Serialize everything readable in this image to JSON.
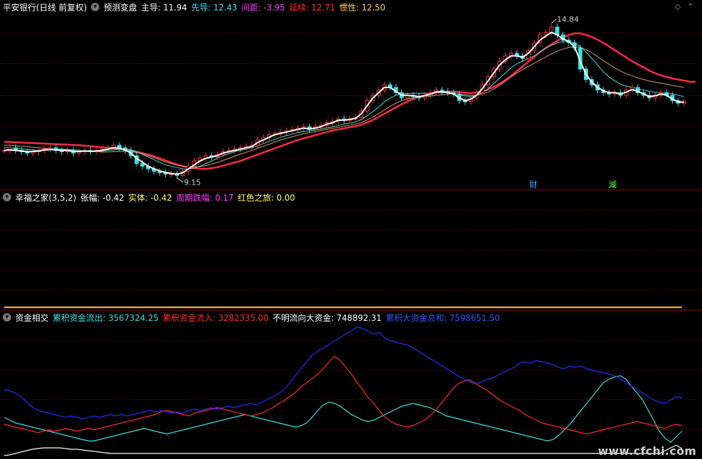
{
  "price_panel": {
    "title": "平安银行(日线 前复权)",
    "indicator_name": "预测变盘",
    "items": [
      {
        "label": "主导:",
        "value": "11.94",
        "color": "#ffffff"
      },
      {
        "label": "先导:",
        "value": "12.43",
        "color": "#40e0ff"
      },
      {
        "label": "间距:",
        "value": "-3.95",
        "color": "#ff40ff"
      },
      {
        "label": "延续:",
        "value": "12.71",
        "color": "#ff3030"
      },
      {
        "label": "惯性:",
        "value": "12.50",
        "color": "#ffcc66"
      }
    ],
    "high_label": "14.84",
    "low_label": "9.15",
    "marker_cai": "财",
    "marker_jian": "減",
    "candles": [
      10.1,
      10.2,
      10.1,
      10.05,
      10.0,
      10.05,
      10.1,
      10.15,
      10.2,
      10.1,
      10.05,
      10.1,
      10.0,
      10.05,
      10.1,
      10.05,
      10.1,
      10.15,
      10.2,
      10.3,
      10.2,
      10.1,
      9.9,
      9.6,
      9.5,
      9.4,
      9.3,
      9.25,
      9.2,
      9.2,
      9.15,
      9.3,
      9.5,
      9.7,
      9.8,
      9.9,
      9.85,
      9.95,
      10.05,
      10.1,
      10.15,
      10.2,
      10.25,
      10.3,
      10.5,
      10.6,
      10.7,
      10.75,
      10.8,
      10.85,
      10.9,
      10.95,
      11.0,
      10.9,
      11.0,
      11.05,
      11.15,
      11.2,
      11.3,
      11.25,
      11.3,
      11.35,
      11.6,
      12.0,
      12.2,
      12.4,
      12.6,
      12.5,
      12.3,
      12.1,
      12.2,
      12.15,
      12.1,
      12.2,
      12.3,
      12.4,
      12.35,
      12.3,
      12.25,
      12.0,
      11.95,
      12.1,
      12.3,
      12.6,
      12.9,
      13.2,
      13.5,
      13.7,
      13.8,
      13.7,
      13.6,
      13.9,
      14.2,
      14.5,
      14.6,
      14.8,
      14.5,
      14.3,
      14.2,
      14.0,
      13.2,
      12.8,
      12.6,
      12.4,
      12.3,
      12.25,
      12.3,
      12.2,
      12.4,
      12.5,
      12.3,
      12.2,
      12.1,
      12.2,
      12.3,
      12.2,
      12.0,
      11.9,
      11.94
    ],
    "ma_white": [
      10.1,
      10.12,
      10.1,
      10.08,
      10.05,
      10.06,
      10.08,
      10.12,
      10.14,
      10.12,
      10.1,
      10.1,
      10.06,
      10.06,
      10.08,
      10.06,
      10.08,
      10.1,
      10.15,
      10.2,
      10.18,
      10.12,
      10.0,
      9.8,
      9.65,
      9.5,
      9.4,
      9.32,
      9.26,
      9.22,
      9.2,
      9.25,
      9.4,
      9.55,
      9.7,
      9.8,
      9.85,
      9.9,
      10.0,
      10.05,
      10.1,
      10.15,
      10.2,
      10.25,
      10.4,
      10.5,
      10.6,
      10.7,
      10.75,
      10.8,
      10.85,
      10.9,
      10.95,
      10.92,
      10.95,
      11.0,
      11.1,
      11.15,
      11.25,
      11.25,
      11.28,
      11.32,
      11.5,
      11.8,
      12.1,
      12.3,
      12.5,
      12.5,
      12.35,
      12.2,
      12.2,
      12.18,
      12.15,
      12.18,
      12.25,
      12.33,
      12.33,
      12.3,
      12.25,
      12.1,
      12.0,
      12.05,
      12.2,
      12.45,
      12.75,
      13.05,
      13.35,
      13.55,
      13.7,
      13.7,
      13.65,
      13.8,
      14.05,
      14.3,
      14.45,
      14.6,
      14.5,
      14.35,
      14.25,
      14.05,
      13.5,
      13.0,
      12.7,
      12.5,
      12.38,
      12.3,
      12.3,
      12.25,
      12.32,
      12.42,
      12.35,
      12.25,
      12.15,
      12.18,
      12.25,
      12.2,
      12.05,
      11.95,
      11.94
    ],
    "ma_cyan": [
      10.2,
      10.2,
      10.18,
      10.16,
      10.14,
      10.12,
      10.1,
      10.1,
      10.12,
      10.14,
      10.15,
      10.14,
      10.12,
      10.1,
      10.08,
      10.06,
      10.06,
      10.08,
      10.1,
      10.12,
      10.14,
      10.15,
      10.12,
      10.05,
      9.95,
      9.85,
      9.75,
      9.65,
      9.55,
      9.5,
      9.45,
      9.4,
      9.38,
      9.42,
      9.5,
      9.6,
      9.7,
      9.8,
      9.9,
      9.98,
      10.05,
      10.1,
      10.15,
      10.2,
      10.28,
      10.36,
      10.45,
      10.52,
      10.6,
      10.66,
      10.72,
      10.78,
      10.82,
      10.85,
      10.88,
      10.92,
      10.96,
      11.0,
      11.05,
      11.1,
      11.14,
      11.18,
      11.28,
      11.42,
      11.58,
      11.75,
      11.95,
      12.1,
      12.2,
      12.25,
      12.27,
      12.28,
      12.28,
      12.28,
      12.28,
      12.3,
      12.3,
      12.3,
      12.28,
      12.22,
      12.18,
      12.15,
      12.2,
      12.3,
      12.45,
      12.65,
      12.85,
      13.05,
      13.25,
      13.4,
      13.5,
      13.6,
      13.7,
      13.85,
      14.0,
      14.1,
      14.2,
      14.25,
      14.25,
      14.2,
      14.05,
      13.85,
      13.6,
      13.35,
      13.1,
      12.9,
      12.75,
      12.62,
      12.55,
      12.5,
      12.45,
      12.4,
      12.35,
      12.32,
      12.3,
      12.28,
      12.25,
      12.2,
      12.15
    ],
    "ma_yellow": [
      10.3,
      10.3,
      10.28,
      10.26,
      10.24,
      10.22,
      10.2,
      10.18,
      10.16,
      10.15,
      10.14,
      10.13,
      10.12,
      10.1,
      10.08,
      10.06,
      10.05,
      10.04,
      10.04,
      10.05,
      10.06,
      10.07,
      10.06,
      10.02,
      9.97,
      9.9,
      9.82,
      9.74,
      9.66,
      9.6,
      9.54,
      9.5,
      9.47,
      9.46,
      9.48,
      9.52,
      9.58,
      9.64,
      9.72,
      9.8,
      9.88,
      9.96,
      10.03,
      10.1,
      10.18,
      10.26,
      10.34,
      10.42,
      10.5,
      10.56,
      10.62,
      10.68,
      10.74,
      10.78,
      10.82,
      10.86,
      10.9,
      10.94,
      10.98,
      11.02,
      11.06,
      11.1,
      11.16,
      11.26,
      11.38,
      11.5,
      11.64,
      11.78,
      11.9,
      12.0,
      12.06,
      12.1,
      12.13,
      12.15,
      12.17,
      12.2,
      12.22,
      12.24,
      12.25,
      12.24,
      12.22,
      12.2,
      12.2,
      12.24,
      12.32,
      12.44,
      12.58,
      12.74,
      12.9,
      13.05,
      13.18,
      13.3,
      13.42,
      13.54,
      13.66,
      13.78,
      13.88,
      13.96,
      14.02,
      14.05,
      14.02,
      13.94,
      13.82,
      13.68,
      13.52,
      13.38,
      13.24,
      13.12,
      13.02,
      12.94,
      12.86,
      12.8,
      12.74,
      12.7,
      12.66,
      12.62,
      12.58,
      12.54,
      12.5
    ],
    "ma_red": [
      10.42,
      10.42,
      10.41,
      10.4,
      10.39,
      10.38,
      10.37,
      10.36,
      10.35,
      10.34,
      10.33,
      10.32,
      10.31,
      10.3,
      10.28,
      10.26,
      10.24,
      10.22,
      10.2,
      10.18,
      10.16,
      10.14,
      10.1,
      10.05,
      10.0,
      9.94,
      9.88,
      9.8,
      9.72,
      9.64,
      9.56,
      9.5,
      9.45,
      9.42,
      9.4,
      9.4,
      9.42,
      9.46,
      9.52,
      9.58,
      9.64,
      9.7,
      9.78,
      9.86,
      9.94,
      10.02,
      10.1,
      10.18,
      10.26,
      10.34,
      10.42,
      10.5,
      10.56,
      10.62,
      10.68,
      10.74,
      10.8,
      10.86,
      10.9,
      10.94,
      10.98,
      11.02,
      11.08,
      11.16,
      11.26,
      11.38,
      11.5,
      11.62,
      11.74,
      11.86,
      11.96,
      12.06,
      12.14,
      12.2,
      12.26,
      12.3,
      12.33,
      12.34,
      12.34,
      12.32,
      12.3,
      12.28,
      12.3,
      12.34,
      12.42,
      12.52,
      12.64,
      12.78,
      12.94,
      13.12,
      13.3,
      13.48,
      13.66,
      13.84,
      14.0,
      14.14,
      14.28,
      14.4,
      14.5,
      14.56,
      14.56,
      14.5,
      14.42,
      14.32,
      14.2,
      14.06,
      13.92,
      13.78,
      13.64,
      13.5,
      13.38,
      13.26,
      13.14,
      13.04,
      12.96,
      12.9,
      12.84,
      12.8,
      12.76,
      12.72,
      12.71
    ]
  },
  "xingfu_panel": {
    "name": "幸福之家(3,5,2)",
    "items": [
      {
        "label": "张幅:",
        "value": "-0.42",
        "color": "#ffffff"
      },
      {
        "label": "实体:",
        "value": "-0.42",
        "color": "#ffff66"
      },
      {
        "label": "周期跌幅:",
        "value": "0.17",
        "color": "#ff40ff"
      },
      {
        "label": "红色之旅:",
        "value": "0.00",
        "color": "#ffff66"
      }
    ]
  },
  "fund_panel": {
    "name": "资金相交",
    "items": [
      {
        "label": "累积资金流出:",
        "value": "3567324.25",
        "color": "#40e0e0"
      },
      {
        "label": "累积资金流入:",
        "value": "3282335.00",
        "color": "#ff3030"
      },
      {
        "label": "不明流向大资金:",
        "value": "748892.31",
        "color": "#ffffff"
      },
      {
        "label": "累积大资金总和:",
        "value": "7598651.50",
        "color": "#3355ff"
      }
    ],
    "blue": [
      560,
      562,
      565,
      570,
      578,
      585,
      590,
      592,
      594,
      596,
      598,
      600,
      598,
      600,
      602,
      600,
      598,
      600,
      598,
      596,
      598,
      596,
      598,
      596,
      594,
      592,
      590,
      592,
      590,
      592,
      594,
      592,
      594,
      590,
      588,
      590,
      588,
      586,
      588,
      586,
      584,
      586,
      584,
      582,
      580,
      582,
      578,
      574,
      570,
      566,
      560,
      550,
      540,
      530,
      520,
      510,
      505,
      500,
      495,
      490,
      485,
      480,
      475,
      470,
      472,
      476,
      480,
      478,
      486,
      490,
      492,
      494,
      496,
      500,
      505,
      510,
      515,
      520,
      525,
      530,
      535,
      540,
      545,
      548,
      552,
      550,
      546,
      544,
      540,
      536,
      532,
      528,
      522,
      520,
      522,
      518,
      520,
      522,
      524,
      528,
      530,
      526,
      528,
      526,
      530,
      532,
      534,
      536,
      538,
      540,
      545,
      550,
      555,
      560,
      565,
      570,
      575,
      578,
      580,
      575,
      570,
      572
    ],
    "red": [
      610,
      612,
      614,
      616,
      618,
      620,
      622,
      620,
      618,
      620,
      618,
      616,
      618,
      620,
      618,
      616,
      618,
      616,
      614,
      612,
      610,
      608,
      606,
      604,
      602,
      600,
      598,
      596,
      592,
      590,
      592,
      594,
      596,
      598,
      594,
      592,
      590,
      588,
      586,
      588,
      590,
      592,
      594,
      596,
      598,
      596,
      594,
      590,
      586,
      580,
      576,
      570,
      564,
      556,
      550,
      544,
      538,
      530,
      520,
      512,
      518,
      528,
      538,
      550,
      560,
      572,
      580,
      590,
      600,
      606,
      610,
      612,
      614,
      612,
      608,
      604,
      598,
      590,
      580,
      570,
      560,
      552,
      548,
      546,
      550,
      556,
      560,
      566,
      572,
      578,
      582,
      586,
      590,
      596,
      600,
      604,
      608,
      610,
      612,
      614,
      616,
      618,
      620,
      622,
      624,
      622,
      620,
      618,
      616,
      614,
      612,
      610,
      608,
      606,
      608,
      610,
      612,
      614,
      616,
      612,
      610,
      612
    ],
    "cyan": [
      600,
      604,
      608,
      610,
      612,
      614,
      616,
      618,
      620,
      622,
      624,
      626,
      628,
      630,
      632,
      634,
      634,
      632,
      630,
      628,
      626,
      624,
      622,
      620,
      618,
      616,
      618,
      620,
      622,
      624,
      622,
      620,
      618,
      616,
      614,
      612,
      610,
      608,
      606,
      604,
      602,
      600,
      598,
      596,
      598,
      600,
      602,
      604,
      606,
      608,
      610,
      612,
      614,
      612,
      608,
      600,
      590,
      582,
      578,
      580,
      584,
      590,
      596,
      600,
      604,
      606,
      604,
      600,
      596,
      592,
      588,
      584,
      582,
      580,
      582,
      584,
      586,
      590,
      594,
      598,
      600,
      602,
      604,
      606,
      608,
      610,
      612,
      614,
      616,
      618,
      620,
      622,
      624,
      626,
      628,
      630,
      632,
      634,
      632,
      626,
      618,
      610,
      600,
      590,
      580,
      570,
      560,
      550,
      545,
      542,
      540,
      545,
      555,
      565,
      575,
      590,
      605,
      620,
      630,
      636,
      628,
      620
    ],
    "white": [
      655,
      654,
      652,
      650,
      648,
      646,
      645,
      644,
      644,
      644,
      644,
      645,
      646,
      646,
      647,
      648,
      649,
      650,
      651,
      652,
      652,
      652,
      652,
      652,
      652,
      652,
      652,
      652,
      652,
      652,
      652,
      652,
      652,
      652,
      652,
      652,
      652,
      652,
      652,
      652,
      652,
      652,
      652,
      652,
      652,
      652,
      652,
      652,
      652,
      652,
      652,
      652,
      652,
      652,
      652,
      652,
      652,
      652,
      652,
      652,
      652,
      652,
      652,
      652,
      652,
      652,
      652,
      652,
      652,
      652,
      652,
      652,
      652,
      652,
      652,
      652,
      652,
      652,
      652,
      652,
      652,
      652,
      652,
      652,
      652,
      652,
      652,
      652,
      652,
      652,
      652,
      652,
      652,
      652,
      652,
      652,
      652,
      652,
      652,
      652,
      652,
      652,
      652,
      652,
      652,
      652,
      652,
      652,
      652,
      652,
      652,
      652,
      652,
      652,
      652,
      652,
      652,
      652,
      648,
      644,
      640,
      645
    ]
  },
  "watermark": "www.cfchi.com",
  "colors": {
    "bg": "#000000",
    "grid": "#8b0000",
    "up": "#ff3030",
    "down": "#40e0e0"
  }
}
